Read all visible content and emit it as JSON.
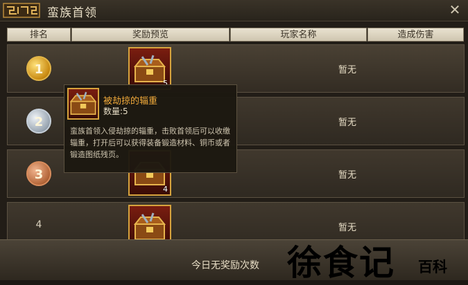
{
  "window": {
    "title": "蛮族首领",
    "close_icon": "close-icon"
  },
  "columns": [
    "排名",
    "奖励预览",
    "玩家名称",
    "造成伤害"
  ],
  "rows": [
    {
      "rank": "1",
      "reward_count": "5",
      "player": "暂无"
    },
    {
      "rank": "2",
      "reward_count": "",
      "player": "暂无"
    },
    {
      "rank": "3",
      "reward_count": "4",
      "player": "暂无"
    },
    {
      "rank": "4",
      "reward_count": "",
      "player": "暂无"
    }
  ],
  "tooltip": {
    "name": "被劫掠的辎重",
    "quantity": "数量:5",
    "description": "蛮族首领入侵劫掠的辎重，击败首领后可以收缴辎重，打开后可以获得装备锻造材料、铜币或者锻造图纸残页。"
  },
  "footer": {
    "daily_status": "今日无奖励次数"
  },
  "watermark": {
    "main": "徐食记",
    "sub": "百科"
  }
}
